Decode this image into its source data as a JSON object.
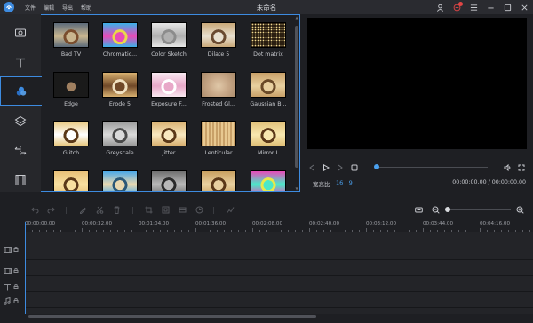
{
  "window": {
    "title": "未命名"
  },
  "menu": [
    "文件",
    "编辑",
    "导出",
    "帮助"
  ],
  "filters": [
    {
      "label": "Bad TV",
      "palette": [
        "#5c6a7a",
        "#c9b68f",
        "#7a4e2e"
      ],
      "style": "bad-tv"
    },
    {
      "label": "Chromatic...",
      "palette": [
        "#3ab0e8",
        "#e84ab8",
        "#e8d84a"
      ],
      "style": "chromatic"
    },
    {
      "label": "Color Sketch",
      "palette": [
        "#e6e6e6",
        "#b0b0b0",
        "#8c8c8c"
      ],
      "style": "sketch"
    },
    {
      "label": "Dilate 5",
      "palette": [
        "#c9a878",
        "#e8e0d0",
        "#6a4a30"
      ],
      "style": "dilate"
    },
    {
      "label": "Dot matrix",
      "palette": [
        "#c8a060",
        "#f0d890",
        "#5a4020"
      ],
      "style": "dots"
    },
    {
      "label": "Edge",
      "palette": [
        "#222222",
        "#a08060",
        "#ffffff"
      ],
      "style": "edge"
    },
    {
      "label": "Erode 5",
      "palette": [
        "#d8b070",
        "#704828",
        "#f0e0c0"
      ],
      "style": "erode"
    },
    {
      "label": "Exposure F...",
      "palette": [
        "#f8e8f0",
        "#e8a8c8",
        "#ffffff"
      ],
      "style": "exposure"
    },
    {
      "label": "Frosted Gl...",
      "palette": [
        "#c8a888",
        "#a88868",
        "#e0c8a8"
      ],
      "style": "frosted"
    },
    {
      "label": "Gaussian B...",
      "palette": [
        "#c8a068",
        "#e8d0a0",
        "#6a4a28"
      ],
      "style": "gaussian"
    },
    {
      "label": "Glitch",
      "palette": [
        "#e8c880",
        "#ffffff",
        "#5a3818"
      ],
      "style": "glitch"
    },
    {
      "label": "Greyscale",
      "palette": [
        "#9a9a9a",
        "#dadada",
        "#4a4a4a"
      ],
      "style": "grey"
    },
    {
      "label": "Jitter",
      "palette": [
        "#d8b070",
        "#f8e8c0",
        "#5a3818"
      ],
      "style": "jitter"
    },
    {
      "label": "Lenticular",
      "palette": [
        "#c8a068",
        "#e8c890",
        "#7a5030"
      ],
      "style": "lenticular"
    },
    {
      "label": "Mirror L",
      "palette": [
        "#e0c078",
        "#f8e8b0",
        "#5a3818"
      ],
      "style": "mirror"
    },
    {
      "label": "",
      "palette": [
        "#e8c078",
        "#f8e0a0",
        "#5a3818"
      ],
      "style": "plain"
    },
    {
      "label": "",
      "palette": [
        "#4aa8e8",
        "#e8d8b0",
        "#2a5878"
      ],
      "style": "cool"
    },
    {
      "label": "",
      "palette": [
        "#707070",
        "#b8b8b8",
        "#2a2a2a"
      ],
      "style": "grey"
    },
    {
      "label": "",
      "palette": [
        "#c8a060",
        "#e8d0a0",
        "#5a3818"
      ],
      "style": "plain"
    },
    {
      "label": "",
      "palette": [
        "#e84ab8",
        "#4ae8c8",
        "#e8e84a"
      ],
      "style": "chromatic"
    }
  ],
  "preview": {
    "aspect_label": "宽高比",
    "aspect_value": "16 : 9",
    "timecode": "00:00:00.00 / 00:00:00.00",
    "progress": 0
  },
  "timeline": {
    "ticks": [
      "00:00:00.00",
      "00:00:32.00",
      "00:01:04.00",
      "00:01:36.00",
      "00:02:08.00",
      "00:02:40.00",
      "00:03:12.00",
      "00:03:44.00",
      "00:04:16.00"
    ],
    "zoom": 0
  },
  "colors": {
    "accent": "#3d8be0",
    "background": "#1e1f23",
    "panel": "#26272b"
  }
}
